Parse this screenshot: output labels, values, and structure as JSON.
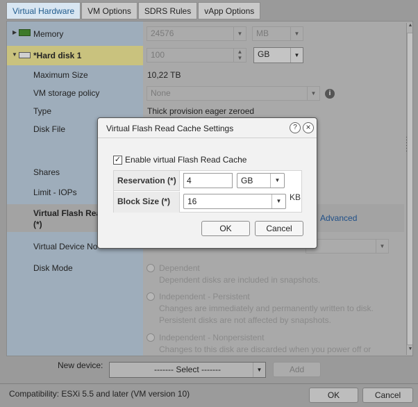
{
  "tabs": [
    "Virtual Hardware",
    "VM Options",
    "SDRS Rules",
    "vApp Options"
  ],
  "rows": {
    "memory": {
      "label": "Memory",
      "value": "24576",
      "unit": "MB"
    },
    "hard_disk": {
      "label": "*Hard disk 1",
      "value": "100",
      "unit": "GB"
    },
    "max_size": {
      "label": "Maximum Size",
      "value": "10,22 TB"
    },
    "storage_policy": {
      "label": "VM storage policy",
      "value": "None"
    },
    "type": {
      "label": "Type",
      "value": "Thick provision eager zeroed"
    },
    "disk_file": {
      "label": "Disk File"
    },
    "shares": {
      "label": "Shares"
    },
    "limit_iops": {
      "label": "Limit - IOPs"
    },
    "vflash": {
      "label_line1": "Virtual Flash Rea",
      "label_line2": "(*)",
      "advanced_link": "Advanced"
    },
    "virtual_device_node": {
      "label": "Virtual Device No"
    },
    "disk_mode": {
      "label": "Disk Mode",
      "options": [
        {
          "title": "Dependent",
          "desc": [
            "Dependent disks are included in snapshots."
          ]
        },
        {
          "title": "Independent - Persistent",
          "desc": [
            "Changes are immediately and permanently written to disk.",
            "Persistent disks are not affected by snapshots."
          ]
        },
        {
          "title": "Independent - Nonpersistent",
          "desc": [
            "Changes to this disk are discarded when you power off or"
          ]
        }
      ]
    }
  },
  "new_device": {
    "label": "New device:",
    "select_value": "------- Select -------",
    "add_label": "Add"
  },
  "compatibility": "Compatibility: ESXi 5.5 and later (VM version 10)",
  "footer_buttons": {
    "ok": "OK",
    "cancel": "Cancel"
  },
  "dialog": {
    "title": "Virtual Flash Read Cache Settings",
    "help": "?",
    "close": "×",
    "checkbox_label": "Enable virtual Flash Read Cache",
    "checkbox_mark": "✓",
    "reservation_label": "Reservation (*)",
    "reservation_value": "4",
    "reservation_unit": "GB",
    "block_size_label": "Block Size (*)",
    "block_size_value": "16",
    "block_size_unit": "KB",
    "ok": "OK",
    "cancel": "Cancel"
  },
  "icons": {
    "expand": "triangle-right",
    "collapse": "triangle-down",
    "info": "info-icon"
  },
  "colors": {
    "active_tab_text": "#1e5a8c",
    "highlight_row": "#c9c27e",
    "link": "#1f4f88"
  }
}
